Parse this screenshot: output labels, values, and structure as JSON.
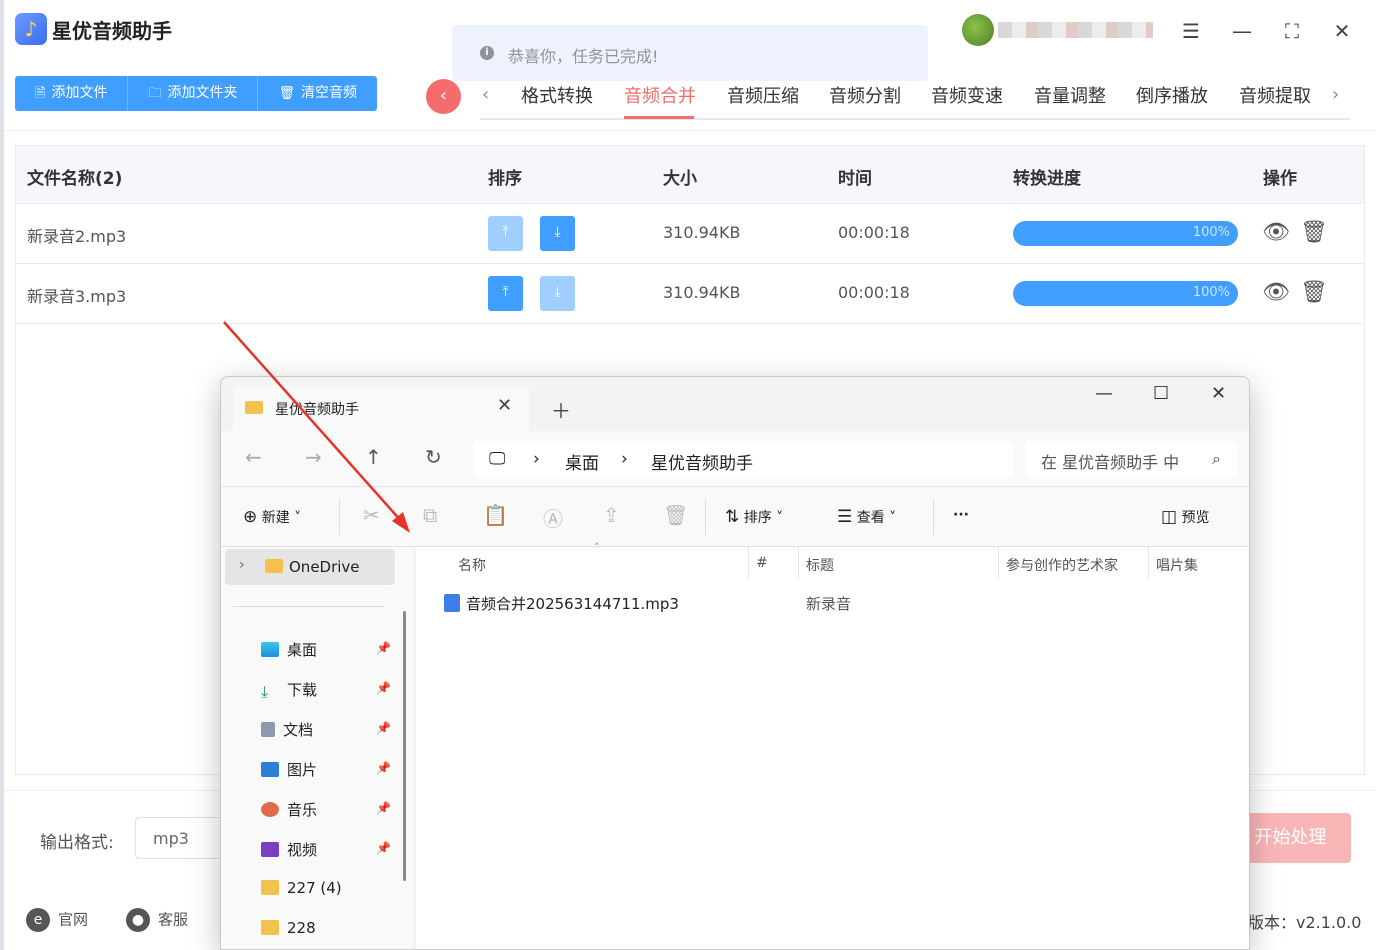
{
  "app": {
    "title": "星优音频助手",
    "toast": "恭喜你，任务已完成!"
  },
  "toolbar": {
    "add_file": "添加文件",
    "add_folder": "添加文件夹",
    "clear_audio": "清空音频"
  },
  "tabs": [
    "格式转换",
    "音频合并",
    "音频压缩",
    "音频分割",
    "音频变速",
    "音量调整",
    "倒序播放",
    "音频提取"
  ],
  "active_tab": "音频合并",
  "table": {
    "headers": [
      "文件名称(2)",
      "排序",
      "大小",
      "时间",
      "转换进度",
      "操作"
    ],
    "rows": [
      {
        "name": "新录音2.mp3",
        "size": "310.94KB",
        "time": "00:00:18",
        "progress": "100%"
      },
      {
        "name": "新录音3.mp3",
        "size": "310.94KB",
        "time": "00:00:18",
        "progress": "100%"
      }
    ]
  },
  "bottom": {
    "output_format_label": "输出格式:",
    "output_format_value": "mp3",
    "start_button": "开始处理",
    "website": "官网",
    "support": "客服",
    "version": "版本：v2.1.0.0"
  },
  "explorer": {
    "tab_title": "星优音频助手",
    "breadcrumb": [
      "桌面",
      "星优音频助手"
    ],
    "search_placeholder": "在 星优音频助手 中",
    "commands": {
      "new": "新建",
      "sort": "排序",
      "view": "查看",
      "more": "···",
      "preview": "预览"
    },
    "sidebar": {
      "onedrive": "OneDrive",
      "items": [
        "桌面",
        "下载",
        "文档",
        "图片",
        "音乐",
        "视频",
        "227 (4)",
        "228"
      ]
    },
    "columns": [
      "名称",
      "#",
      "标题",
      "参与创作的艺术家",
      "唱片集"
    ],
    "files": [
      {
        "name": "音频合并202563144711.mp3",
        "title": "新录音"
      }
    ]
  },
  "colors": {
    "primary": "#409eff",
    "accent": "#f56c6c"
  }
}
